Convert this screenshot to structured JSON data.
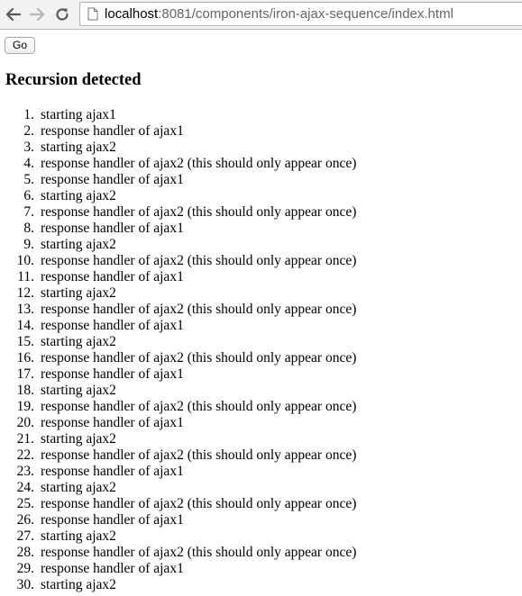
{
  "browser": {
    "url_host": "localhost",
    "url_rest": ":8081/components/iron-ajax-sequence/index.html"
  },
  "page": {
    "go_label": "Go",
    "heading": "Recursion detected",
    "log": [
      {
        "num": "1.",
        "text": "starting ajax1"
      },
      {
        "num": "2.",
        "text": "response handler of ajax1"
      },
      {
        "num": "3.",
        "text": "starting ajax2"
      },
      {
        "num": "4.",
        "text": "response handler of ajax2 (this should only appear once)"
      },
      {
        "num": "5.",
        "text": "response handler of ajax1"
      },
      {
        "num": "6.",
        "text": "starting ajax2"
      },
      {
        "num": "7.",
        "text": "response handler of ajax2 (this should only appear once)"
      },
      {
        "num": "8.",
        "text": "response handler of ajax1"
      },
      {
        "num": "9.",
        "text": "starting ajax2"
      },
      {
        "num": "10.",
        "text": "response handler of ajax2 (this should only appear once)"
      },
      {
        "num": "11.",
        "text": "response handler of ajax1"
      },
      {
        "num": "12.",
        "text": "starting ajax2"
      },
      {
        "num": "13.",
        "text": "response handler of ajax2 (this should only appear once)"
      },
      {
        "num": "14.",
        "text": "response handler of ajax1"
      },
      {
        "num": "15.",
        "text": "starting ajax2"
      },
      {
        "num": "16.",
        "text": "response handler of ajax2 (this should only appear once)"
      },
      {
        "num": "17.",
        "text": "response handler of ajax1"
      },
      {
        "num": "18.",
        "text": "starting ajax2"
      },
      {
        "num": "19.",
        "text": "response handler of ajax2 (this should only appear once)"
      },
      {
        "num": "20.",
        "text": "response handler of ajax1"
      },
      {
        "num": "21.",
        "text": "starting ajax2"
      },
      {
        "num": "22.",
        "text": "response handler of ajax2 (this should only appear once)"
      },
      {
        "num": "23.",
        "text": "response handler of ajax1"
      },
      {
        "num": "24.",
        "text": "starting ajax2"
      },
      {
        "num": "25.",
        "text": "response handler of ajax2 (this should only appear once)"
      },
      {
        "num": "26.",
        "text": "response handler of ajax1"
      },
      {
        "num": "27.",
        "text": "starting ajax2"
      },
      {
        "num": "28.",
        "text": "response handler of ajax2 (this should only appear once)"
      },
      {
        "num": "29.",
        "text": "response handler of ajax1"
      },
      {
        "num": "30.",
        "text": "starting ajax2"
      }
    ]
  },
  "icons": {
    "back": "arrow-left-icon",
    "forward": "arrow-right-icon",
    "reload": "reload-icon",
    "page": "page-icon"
  }
}
